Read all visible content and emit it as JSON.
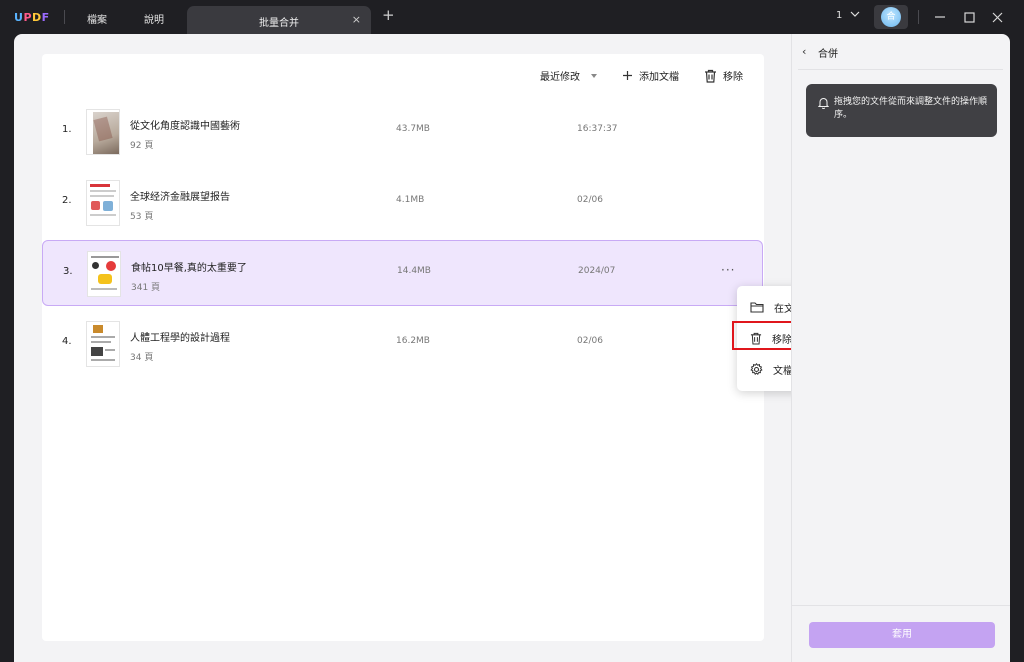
{
  "app": {
    "logo": "UPDF",
    "menu": [
      "檔案",
      "說明"
    ],
    "tab_label": "批量合并",
    "tab_close": "×",
    "add_tab": "+",
    "page_count": "1",
    "avatar_initial": "合"
  },
  "toolbar": {
    "sort_label": "最近修改",
    "add_label": "添加文檔",
    "remove_label": "移除"
  },
  "files": [
    {
      "index": "1.",
      "title": "從文化角度認識中國藝術",
      "pages": "92 頁",
      "size": "43.7MB",
      "date": "16:37:37"
    },
    {
      "index": "2.",
      "title": "全球经济金融展望报告",
      "pages": "53 頁",
      "size": "4.1MB",
      "date": "02/06"
    },
    {
      "index": "3.",
      "title": "食帖10早餐,真的太重要了",
      "pages": "341 頁",
      "size": "14.4MB",
      "date": "2024/07",
      "more": "···"
    },
    {
      "index": "4.",
      "title": "人體工程學的設計過程",
      "pages": "34 頁",
      "size": "16.2MB",
      "date": "02/06"
    }
  ],
  "context_menu": {
    "items": [
      "在文件夾中顯示",
      "移除文檔",
      "文檔設定"
    ]
  },
  "side_panel": {
    "back": "‹",
    "title": "合併",
    "tip": "拖拽您的文件從而來調整文件的操作順序。",
    "apply_label": "套用"
  },
  "colors": {
    "accent": "#c4a3f2",
    "selected_row_bg": "#efe6fd",
    "highlight_box": "#e0161c"
  }
}
